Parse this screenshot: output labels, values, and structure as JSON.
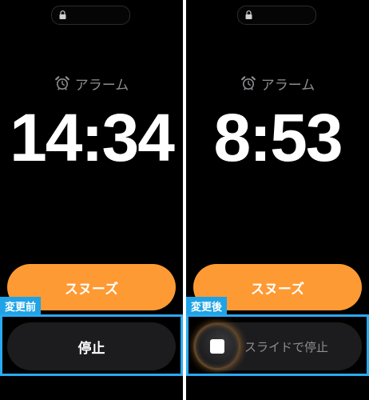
{
  "before": {
    "alarm_label": "アラーム",
    "time": "14:34",
    "snooze_label": "スヌーズ",
    "stop_label": "停止",
    "tag": "変更前"
  },
  "after": {
    "alarm_label": "アラーム",
    "time": "8:53",
    "snooze_label": "スヌーズ",
    "slide_label": "スライドで停止",
    "tag": "変更後"
  },
  "colors": {
    "accent": "#fe9a33",
    "highlight": "#2aa9f0",
    "tag_bg": "#1fa3e6",
    "background": "#000000"
  },
  "icons": [
    "lock-icon",
    "alarm-clock-icon",
    "stop-square-icon"
  ]
}
